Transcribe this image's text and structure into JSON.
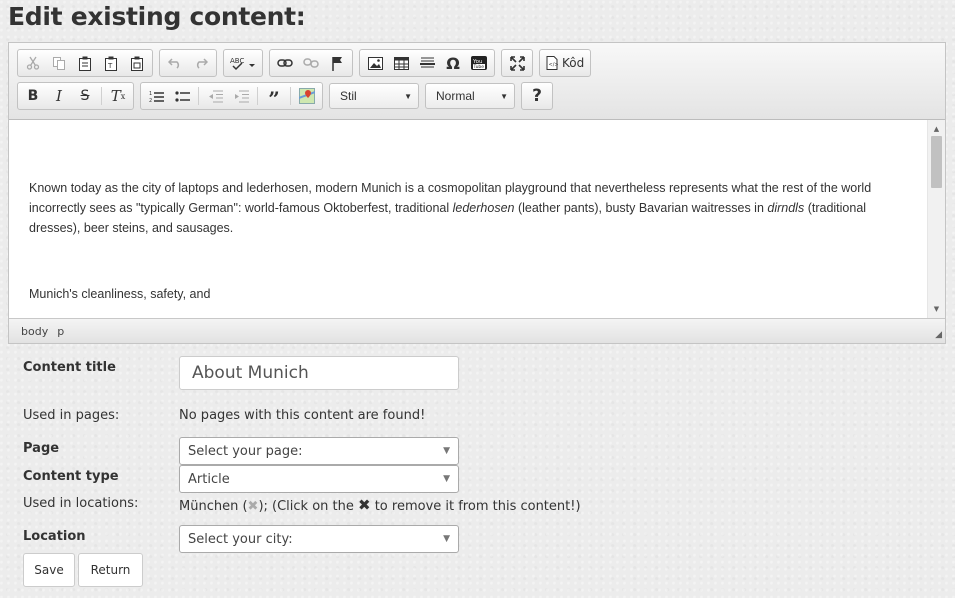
{
  "page_title": "Edit existing content:",
  "toolbar": {
    "row1": [
      {
        "name": "cut-icon",
        "glyph": "✂"
      },
      {
        "name": "copy-icon",
        "glyph": "⧉"
      },
      {
        "name": "paste-icon",
        "glyph": "📋"
      },
      {
        "name": "paste-text-icon",
        "glyph": "📋"
      },
      {
        "name": "paste-word-icon",
        "glyph": "📋"
      },
      {
        "name": "undo-icon",
        "glyph": "↶"
      },
      {
        "name": "redo-icon",
        "glyph": "↷"
      },
      {
        "name": "spellcheck-icon",
        "glyph": "ABC"
      },
      {
        "name": "link-icon",
        "glyph": "🔗"
      },
      {
        "name": "unlink-icon",
        "glyph": "⛓"
      },
      {
        "name": "anchor-flag-icon",
        "glyph": "⚑"
      },
      {
        "name": "image-icon",
        "glyph": "🖼"
      },
      {
        "name": "table-icon",
        "glyph": "▦"
      },
      {
        "name": "horizontal-line-icon",
        "glyph": "☰"
      },
      {
        "name": "special-char-icon",
        "glyph": "Ω"
      },
      {
        "name": "youtube-icon",
        "glyph": "▶"
      },
      {
        "name": "maximize-icon",
        "glyph": "⤢"
      }
    ],
    "source_label": "Kôd",
    "style_combo": "Stil",
    "format_combo": "Normal",
    "help_glyph": "?"
  },
  "editor_content": {
    "p1_a": "Known today as the city of laptops and lederhosen, modern Munich is a cosmopolitan playground that nevertheless represents what the rest of the world incorrectly sees as \"typically German\": world-famous Oktoberfest, traditional ",
    "p1_em1": "lederhosen",
    "p1_b": " (leather pants), busty Bavarian waitresses in ",
    "p1_em2": "dirndls",
    "p1_c": " (traditional dresses), beer steins, and sausages.",
    "p2": "Munich's cleanliness, safety, and"
  },
  "statusbar": {
    "path1": "body",
    "path2": "p"
  },
  "form": {
    "content_title_label": "Content title",
    "content_title_value": "About Munich",
    "used_in_pages_label": "Used in pages:",
    "used_in_pages_value": "No pages with this content are found!",
    "page_label": "Page",
    "page_select": "Select your page:",
    "content_type_label": "Content type",
    "content_type_select": "Article",
    "used_in_locations_label": "Used in locations:",
    "location_name": "München (",
    "location_after": "); (Click on the ",
    "location_hint_end": " to remove it from this content!)",
    "location_label": "Location",
    "location_select": "Select your city:",
    "save_button": "Save",
    "return_button": "Return"
  }
}
